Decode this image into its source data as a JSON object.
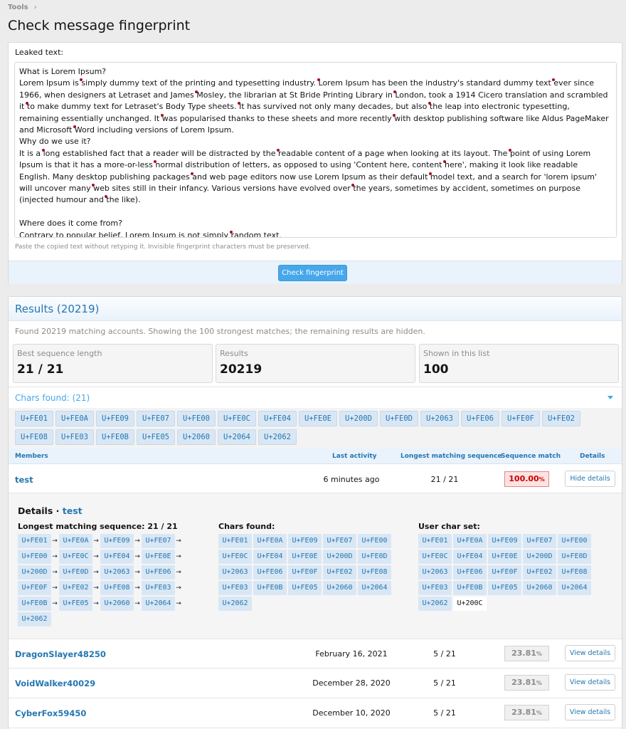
{
  "breadcrumb": {
    "root": "Tools"
  },
  "page_title": "Check message fingerprint",
  "form": {
    "label": "Leaked text:",
    "paragraphs": [
      "What is Lorem Ipsum?",
      "Lorem Ipsum is simply dummy text of the printing and typesetting industry. Lorem Ipsum has been the industry's standard dummy text ever since 1966, when designers at Letraset and James Mosley, the librarian at St Bride Printing Library in London, took a 1914 Cicero translation and scrambled it to make dummy text for Letraset's Body Type sheets. It has survived not only many decades, but also the leap into electronic typesetting, remaining essentially unchanged. It was popularised thanks to these sheets and more recently with desktop publishing software like Aldus PageMaker and Microsoft Word including versions of Lorem Ipsum.",
      "Why do we use it?",
      "It is a long established fact that a reader will be distracted by the readable content of a page when looking at its layout. The point of using Lorem Ipsum is that it has a more-or-less normal distribution of letters, as opposed to using 'Content here, content here', making it look like readable English. Many desktop publishing packages and web page editors now use Lorem Ipsum as their default model text, and a search for 'lorem ipsum' will uncover many web sites still in their infancy. Various versions have evolved over the years, sometimes by accident, sometimes on purpose (injected humour and the like).",
      "",
      "Where does it come from?",
      "Contrary to popular belief, Lorem Ipsum is not simply random text."
    ],
    "hint": "Paste the copied text without retyping it. Invisible fingerprint characters must be preserved.",
    "submit_label": "Check fingerprint"
  },
  "results": {
    "title": "Results (20219)",
    "found_text": "Found 20219 matching accounts. Showing the 100 strongest matches; the remaining results are hidden.",
    "stats": [
      {
        "key": "Best sequence length",
        "value": "21 / 21"
      },
      {
        "key": "Results",
        "value": "20219"
      },
      {
        "key": "Shown in this list",
        "value": "100"
      }
    ],
    "chars_found_label": "Chars found: (21)",
    "chars": [
      "U+FE01",
      "U+FE0A",
      "U+FE09",
      "U+FE07",
      "U+FE00",
      "U+FE0C",
      "U+FE04",
      "U+FE0E",
      "U+200D",
      "U+FE0D",
      "U+2063",
      "U+FE06",
      "U+FE0F",
      "U+FE02",
      "U+FE08",
      "U+FE03",
      "U+FE0B",
      "U+FE05",
      "U+2060",
      "U+2064",
      "U+2062"
    ],
    "columns": {
      "members": "Members",
      "last_activity": "Last activity",
      "longest": "Longest matching sequence",
      "match": "Sequence match",
      "details": "Details"
    },
    "rows": [
      {
        "name": "test",
        "when": "6 minutes ago",
        "seq": "21 / 21",
        "pct": "100.00",
        "action": "Hide details"
      },
      {
        "name": "DragonSlayer48250",
        "when": "February 16, 2021",
        "seq": "5 / 21",
        "pct": "23.81",
        "action": "View details"
      },
      {
        "name": "VoidWalker40029",
        "when": "December 28, 2020",
        "seq": "5 / 21",
        "pct": "23.81",
        "action": "View details"
      },
      {
        "name": "CyberFox59450",
        "when": "December 10, 2020",
        "seq": "5 / 21",
        "pct": "23.81",
        "action": "View details"
      }
    ],
    "pct_unit": "%",
    "details": {
      "title_prefix": "Details · ",
      "user": "test",
      "longest_label": "Longest matching sequence: 21 / 21",
      "sequence": [
        "U+FE01",
        "U+FE0A",
        "U+FE09",
        "U+FE07",
        "U+FE00",
        "U+FE0C",
        "U+FE04",
        "U+FE0E",
        "U+200D",
        "U+FE0D",
        "U+2063",
        "U+FE06",
        "U+FE0F",
        "U+FE02",
        "U+FE08",
        "U+FE03",
        "U+FE0B",
        "U+FE05",
        "U+2060",
        "U+2064",
        "U+2062"
      ],
      "chars_found_label": "Chars found:",
      "chars_found": [
        "U+FE01",
        "U+FE0A",
        "U+FE09",
        "U+FE07",
        "U+FE00",
        "U+FE0C",
        "U+FE04",
        "U+FE0E",
        "U+200D",
        "U+FE0D",
        "U+2063",
        "U+FE06",
        "U+FE0F",
        "U+FE02",
        "U+FE08",
        "U+FE03",
        "U+FE0B",
        "U+FE05",
        "U+2060",
        "U+2064",
        "U+2062"
      ],
      "user_set_label": "User char set:",
      "user_set": [
        "U+FE01",
        "U+FE0A",
        "U+FE09",
        "U+FE07",
        "U+FE00",
        "U+FE0C",
        "U+FE04",
        "U+FE0E",
        "U+200D",
        "U+FE0D",
        "U+2063",
        "U+FE06",
        "U+FE0F",
        "U+FE02",
        "U+FE08",
        "U+FE03",
        "U+FE0B",
        "U+FE05",
        "U+2060",
        "U+2064",
        "U+2062",
        "U+200C"
      ],
      "user_set_unmatched": "U+200C"
    }
  },
  "colors": {
    "accent": "#2577b1",
    "button": "#47a7eb",
    "marker": "#a80f1f",
    "hot_bg": "#fde2e2"
  }
}
